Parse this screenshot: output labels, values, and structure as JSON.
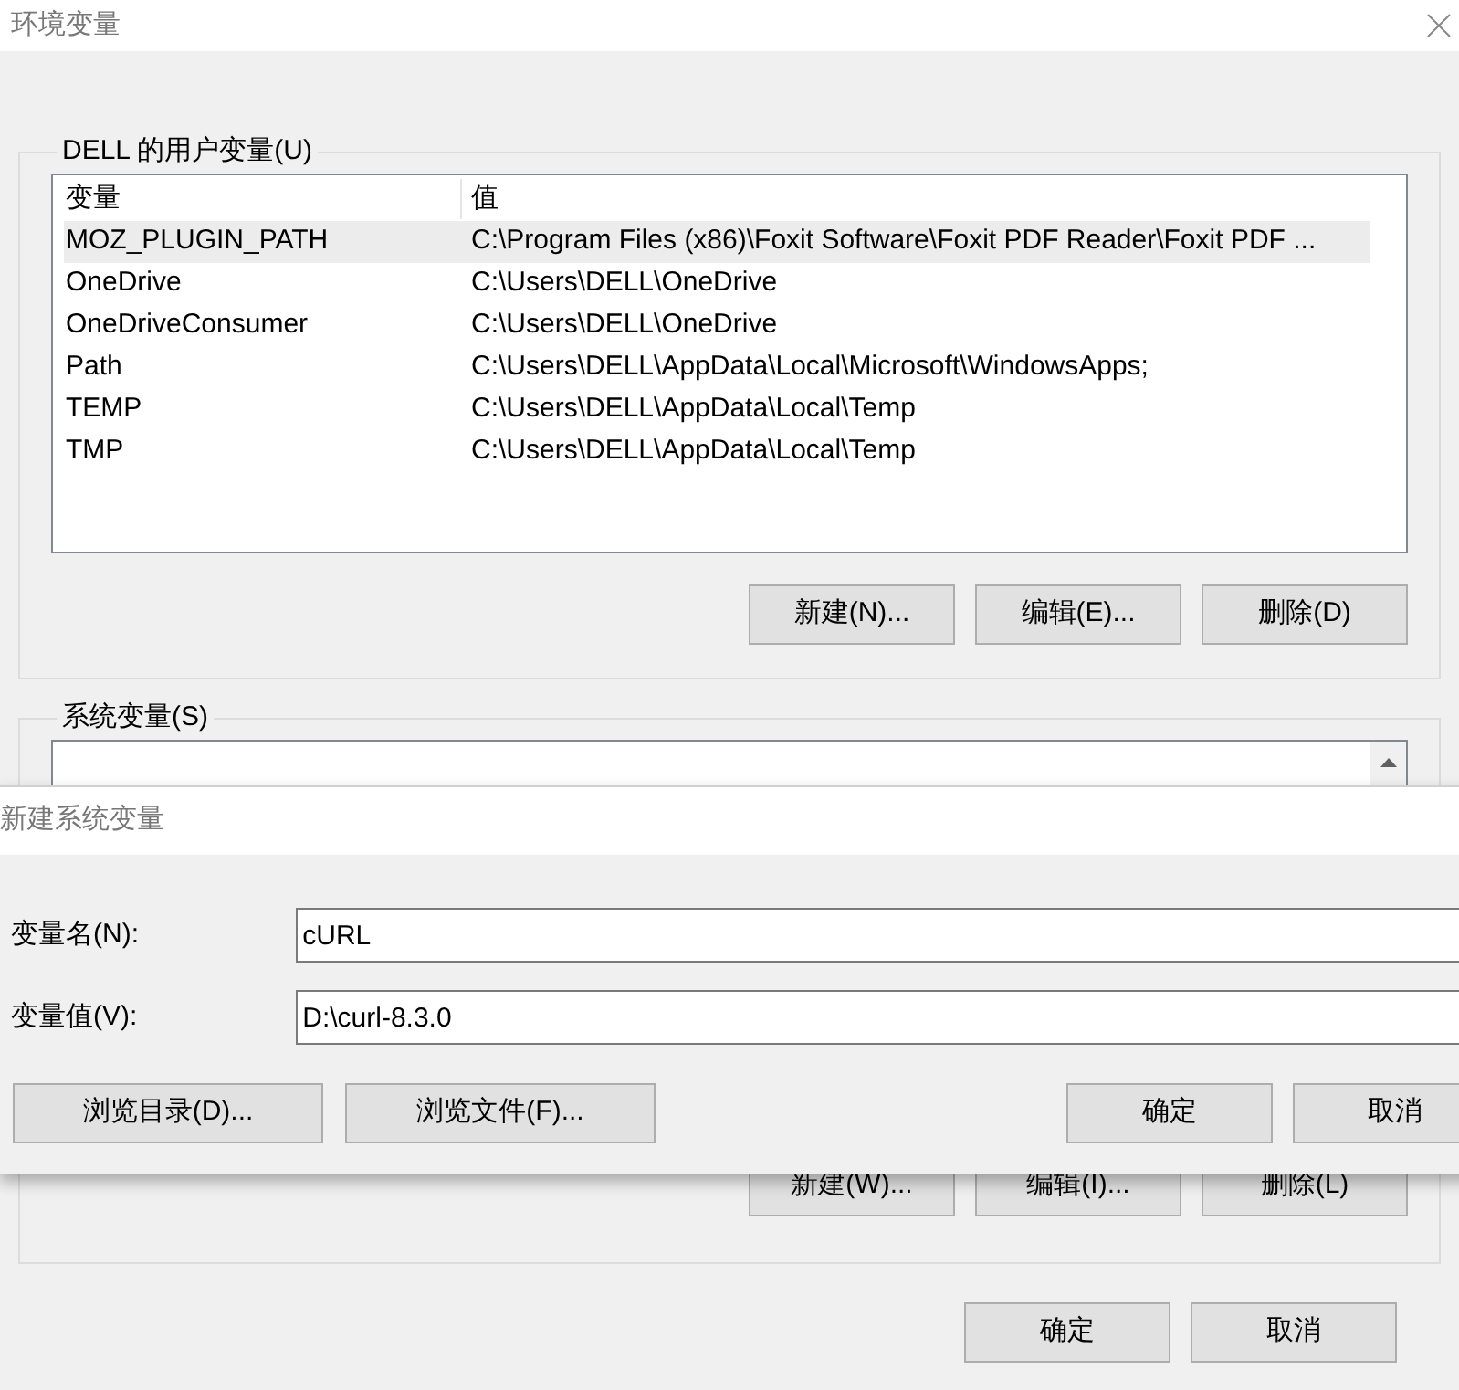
{
  "window": {
    "title": "环境变量"
  },
  "user_vars": {
    "title": "DELL 的用户变量(U)",
    "columns": [
      "变量",
      "值"
    ],
    "rows": [
      {
        "name": "MOZ_PLUGIN_PATH",
        "value": "C:\\Program Files (x86)\\Foxit Software\\Foxit PDF Reader\\Foxit PDF ...",
        "selected": true
      },
      {
        "name": "OneDrive",
        "value": "C:\\Users\\DELL\\OneDrive",
        "selected": false
      },
      {
        "name": "OneDriveConsumer",
        "value": "C:\\Users\\DELL\\OneDrive",
        "selected": false
      },
      {
        "name": "Path",
        "value": "C:\\Users\\DELL\\AppData\\Local\\Microsoft\\WindowsApps;",
        "selected": false
      },
      {
        "name": "TEMP",
        "value": "C:\\Users\\DELL\\AppData\\Local\\Temp",
        "selected": false
      },
      {
        "name": "TMP",
        "value": "C:\\Users\\DELL\\AppData\\Local\\Temp",
        "selected": false
      }
    ],
    "buttons": [
      "新建(N)...",
      "编辑(E)...",
      "删除(D)"
    ]
  },
  "system_vars": {
    "title": "系统变量(S)",
    "buttons": [
      "新建(W)...",
      "编辑(I)...",
      "删除(L)"
    ]
  },
  "buttons": [
    "确定",
    "取消"
  ],
  "new_var_dialog": {
    "title": "新建系统变量",
    "fields": [
      {
        "label": "变量名(N):",
        "value": "cURL"
      },
      {
        "label": "变量值(V):",
        "value": "D:\\curl-8.3.0"
      }
    ],
    "left_buttons": [
      "浏览目录(D)...",
      "浏览文件(F)..."
    ],
    "right_buttons": [
      "确定",
      "取消"
    ]
  }
}
